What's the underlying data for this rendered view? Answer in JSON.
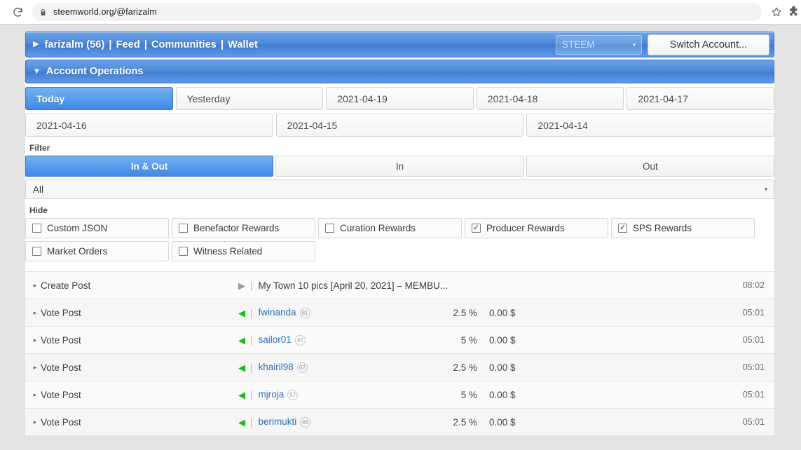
{
  "browser": {
    "url": "steemworld.org/@farizalm",
    "reload_icon": "reload-icon",
    "lock_icon": "lock-icon",
    "star_icon": "star-icon",
    "extension_icon": "extension-icon"
  },
  "navbar": {
    "caret": "▶",
    "account": "farizalm (56)",
    "sep": "|",
    "links": [
      "Feed",
      "Communities",
      "Wallet"
    ],
    "chain_select": {
      "value": "STEEM",
      "arrow": "▾"
    },
    "switch_account_label": "Switch Account..."
  },
  "section": {
    "caret": "▼",
    "title": "Account Operations"
  },
  "date_tabs": {
    "row1": [
      "Today",
      "Yesterday",
      "2021-04-19",
      "2021-04-18",
      "2021-04-17"
    ],
    "row2": [
      "2021-04-16",
      "2021-04-15",
      "2021-04-14"
    ],
    "active": "Today"
  },
  "filter": {
    "label": "Filter",
    "segments": [
      "In & Out",
      "In",
      "Out"
    ],
    "active": "In & Out",
    "select": {
      "value": "All",
      "arrow": "▾"
    }
  },
  "hide": {
    "label": "Hide",
    "check_glyph": "✓",
    "items": [
      {
        "label": "Custom JSON",
        "checked": false
      },
      {
        "label": "Benefactor Rewards",
        "checked": false
      },
      {
        "label": "Curation Rewards",
        "checked": false
      },
      {
        "label": "Producer Rewards",
        "checked": true
      },
      {
        "label": "SPS Rewards",
        "checked": true
      },
      {
        "label": "Market Orders",
        "checked": false
      },
      {
        "label": "Witness Related",
        "checked": false
      }
    ]
  },
  "operations": {
    "caret": "▸",
    "pipe": "|",
    "rows": [
      {
        "type": "Create Post",
        "direction": "out",
        "dir_glyph": "▶",
        "target": "My Town 10 pics [April 20, 2021] – MEMBU...",
        "is_link": false,
        "rep": "",
        "percent": "",
        "amount": "",
        "time": "08:02"
      },
      {
        "type": "Vote Post",
        "direction": "in",
        "dir_glyph": "◀",
        "target": "fwinanda",
        "is_link": true,
        "rep": "81",
        "percent": "2.5 %",
        "amount": "0.00 $",
        "time": "05:01"
      },
      {
        "type": "Vote Post",
        "direction": "in",
        "dir_glyph": "◀",
        "target": "sailor01",
        "is_link": true,
        "rep": "47",
        "percent": "5 %",
        "amount": "0.00 $",
        "time": "05:01"
      },
      {
        "type": "Vote Post",
        "direction": "in",
        "dir_glyph": "◀",
        "target": "khairil98",
        "is_link": true,
        "rep": "62",
        "percent": "2.5 %",
        "amount": "0.00 $",
        "time": "05:01"
      },
      {
        "type": "Vote Post",
        "direction": "in",
        "dir_glyph": "◀",
        "target": "mjroja",
        "is_link": true,
        "rep": "57",
        "percent": "5 %",
        "amount": "0.00 $",
        "time": "05:01"
      },
      {
        "type": "Vote Post",
        "direction": "in",
        "dir_glyph": "◀",
        "target": "berimukti",
        "is_link": true,
        "rep": "66",
        "percent": "2.5 %",
        "amount": "0.00 $",
        "time": "05:01"
      }
    ]
  },
  "colors": {
    "accent_blue": "#3f8ae6",
    "nav_blue": "#4a86d8",
    "link_blue": "#2c6fb5",
    "in_green": "#17bd17",
    "page_bg": "#e3e3e3"
  }
}
